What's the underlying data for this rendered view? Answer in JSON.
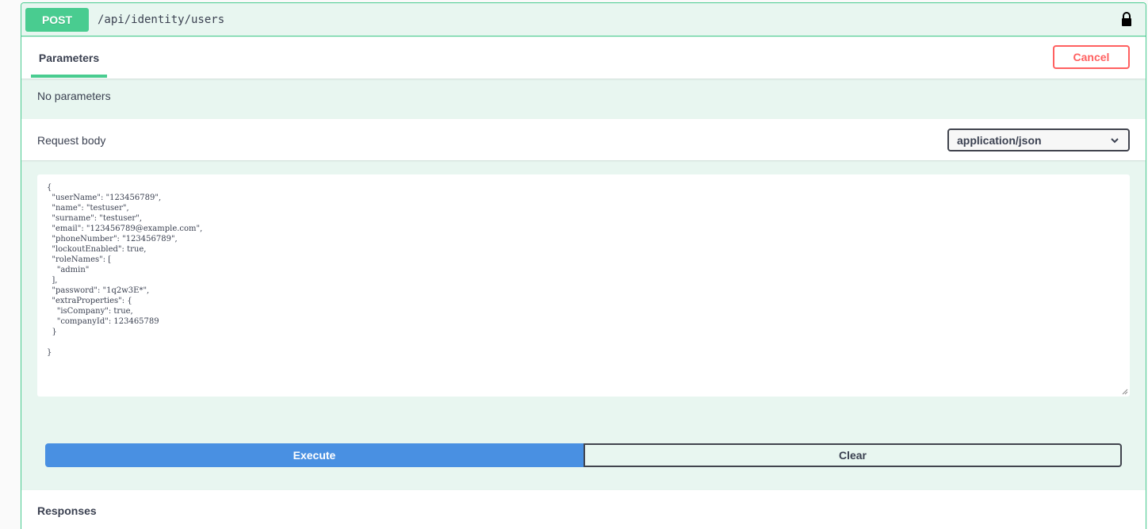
{
  "operation": {
    "method": "POST",
    "path": "/api/identity/users",
    "lock_icon": "lock-icon",
    "method_color": "#49cc90"
  },
  "parameters": {
    "tab_label": "Parameters",
    "cancel_label": "Cancel",
    "empty_text": "No parameters"
  },
  "request_body": {
    "label": "Request body",
    "content_type": "application/json",
    "json": "{\n  \"userName\": \"123456789\",\n  \"name\": \"testuser\",\n  \"surname\": \"testuser\",\n  \"email\": \"123456789@example.com\",\n  \"phoneNumber\": \"123456789\",\n  \"lockoutEnabled\": true,\n  \"roleNames\": [\n    \"admin\"\n  ],\n  \"password\": \"1q2w3E*\",\n  \"extraProperties\": {\n    \"isCompany\": true,\n    \"companyId\": 123465789\n  }\n\n}"
  },
  "actions": {
    "execute_label": "Execute",
    "clear_label": "Clear",
    "execute_color": "#4990e2"
  },
  "responses": {
    "label": "Responses"
  }
}
